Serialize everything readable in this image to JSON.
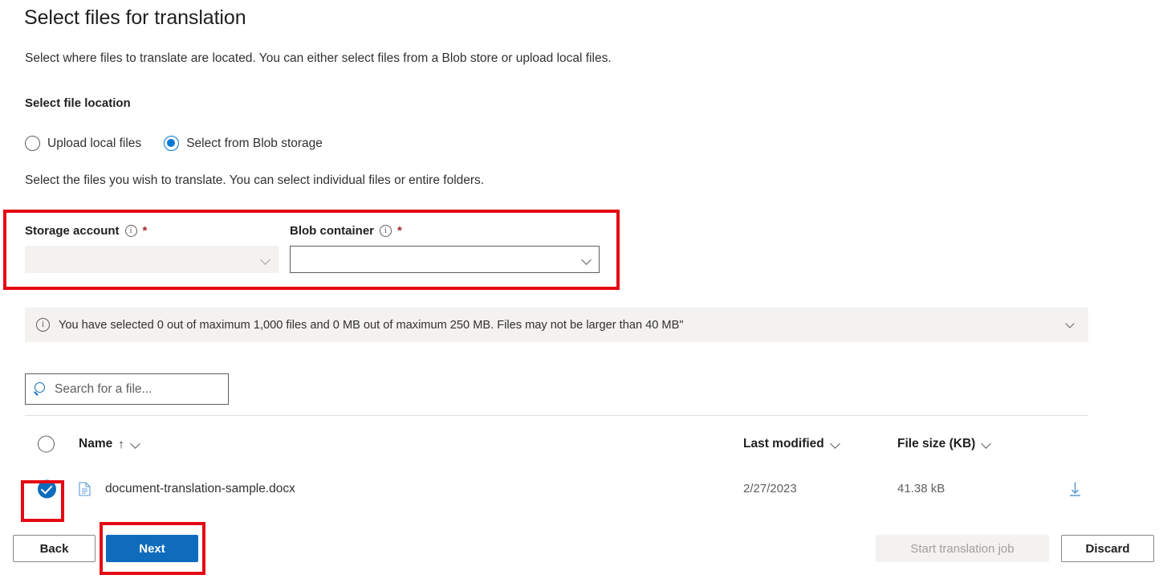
{
  "page": {
    "title": "Select files for translation",
    "intro": "Select where files to translate are located. You can either select files from a Blob store or upload local files.",
    "section_label": "Select file location",
    "sub_instruction": "Select the files you wish to translate. You can select individual files or entire folders."
  },
  "location_radios": {
    "options": [
      {
        "label": "Upload local files",
        "checked": false
      },
      {
        "label": "Select from Blob storage",
        "checked": true
      }
    ]
  },
  "fields": {
    "storage_account": {
      "label": "Storage account",
      "required_marker": "*",
      "info_glyph": "i",
      "value": "",
      "disabled": true
    },
    "blob_container": {
      "label": "Blob container",
      "required_marker": "*",
      "info_glyph": "i",
      "value": "",
      "disabled": false
    }
  },
  "banner": {
    "info_glyph": "i",
    "text": "You have selected 0 out of maximum 1,000 files and 0 MB out of maximum 250 MB. Files may not be larger than 40 MB\""
  },
  "search": {
    "placeholder": "Search for a file...",
    "value": ""
  },
  "table": {
    "columns": {
      "name": "Name",
      "name_sort_arrow": "↑",
      "last_modified": "Last modified",
      "file_size": "File size (KB)"
    },
    "rows": [
      {
        "selected": true,
        "name": "document-translation-sample.docx",
        "last_modified": "2/27/2023",
        "file_size": "41.38 kB",
        "download": "download-icon"
      }
    ]
  },
  "footer": {
    "back": "Back",
    "next": "Next",
    "start_translation_job": "Start translation job",
    "discard": "Discard"
  },
  "colors": {
    "accent_blue": "#0f6cbd",
    "radio_blue": "#0078d4",
    "annotation_red": "#e50914",
    "required_red": "#a4262c",
    "banner_bg": "#f3f2f1",
    "disabled_text": "#a19f9d"
  }
}
